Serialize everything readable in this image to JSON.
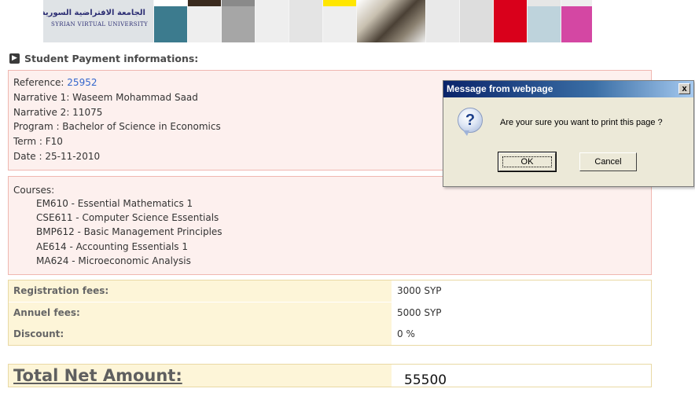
{
  "banner": {
    "logo_arabic": "الجامعة الافتراضية السورية",
    "logo_english": "SYRIAN VIRTUAL UNIVERSITY"
  },
  "section_title": "Student Payment informations:",
  "info": {
    "reference_label": "Reference: ",
    "reference_value": "25952",
    "narrative1": "Narrative 1: Waseem Mohammad Saad",
    "narrative2": "Narrative 2: 11075",
    "program": "Program : Bachelor of Science in Economics",
    "term": "Term : F10",
    "date": "Date : 25-11-2010"
  },
  "courses": {
    "title": "Courses:",
    "items": [
      "EM610 - Essential Mathematics 1",
      "CSE611 - Computer Science Essentials",
      "BMP612 - Basic Management Principles",
      "AE614 - Accounting Essentials 1",
      "MA624 - Microeconomic Analysis"
    ]
  },
  "fees": [
    {
      "label": "Registration fees:",
      "value": "3000 SYP"
    },
    {
      "label": "Annuel fees:",
      "value": "5000 SYP"
    },
    {
      "label": "Discount:",
      "value": "0 %"
    }
  ],
  "total": {
    "label": "Total Net Amount:",
    "value": "55500"
  },
  "dialog": {
    "title": "Message from webpage",
    "close": "x",
    "icon": "question-icon",
    "message": "Are your sure you want to print this page ?",
    "ok_label": "OK",
    "cancel_label": "Cancel"
  },
  "colors": {
    "info_bg": "#fdf0ee",
    "info_border": "#f0b7b0",
    "fee_label_bg": "#fdf5d8",
    "link": "#3366cc",
    "dialog_title": "#0a246a"
  }
}
